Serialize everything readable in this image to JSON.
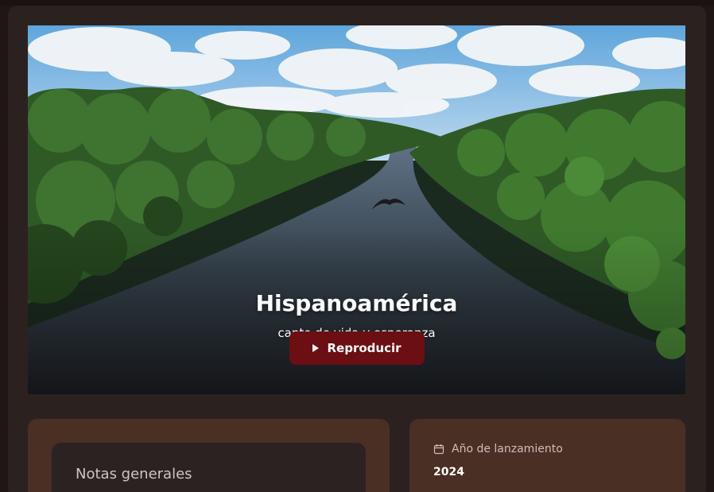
{
  "hero": {
    "title": "Hispanoamérica",
    "subtitle": "canto de vida y esperanza",
    "play_label": "Reproducir",
    "image": "river-rainforest-aerial"
  },
  "notes": {
    "title": "Notas generales"
  },
  "release": {
    "label": "Año de lanzamiento",
    "value": "2024",
    "icon": "calendar-icon"
  },
  "colors": {
    "background": "#1e1716",
    "panel": "#2b2220",
    "card": "#4a2f25",
    "notes_box": "#2a2322",
    "play_button": "#6b0f12"
  }
}
